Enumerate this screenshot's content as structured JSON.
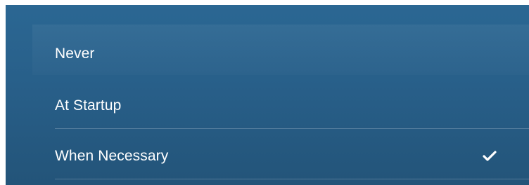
{
  "options": [
    {
      "label": "Never",
      "selected": false
    },
    {
      "label": "At Startup",
      "selected": false
    },
    {
      "label": "When Necessary",
      "selected": true
    }
  ],
  "selected_icon": "checkmark-icon",
  "colors": {
    "panel_top": "#2b6793",
    "panel_bottom": "#235479",
    "text": "#ffffff",
    "divider": "rgba(255,255,255,0.22)"
  }
}
